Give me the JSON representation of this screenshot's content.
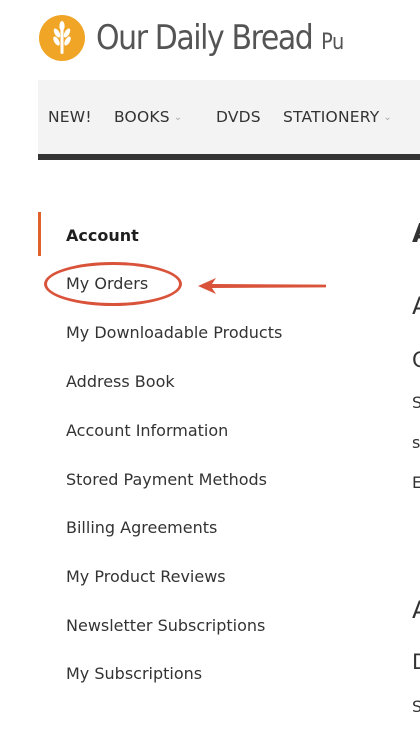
{
  "brand": {
    "name": "Our Daily Bread",
    "name_tail": "Pu",
    "logo_color": "#f0a527"
  },
  "nav": {
    "items": [
      {
        "label": "NEW!",
        "has_dropdown": false
      },
      {
        "label": "BOOKS",
        "has_dropdown": true
      },
      {
        "label": "DVDS",
        "has_dropdown": false
      },
      {
        "label": "STATIONERY",
        "has_dropdown": true
      }
    ]
  },
  "sidebar": {
    "items": [
      {
        "label": "Account",
        "active": true
      },
      {
        "label": "My Orders",
        "highlighted": true
      },
      {
        "label": "My Downloadable Products"
      },
      {
        "label": "Address Book"
      },
      {
        "label": "Account Information"
      },
      {
        "label": "Stored Payment Methods"
      },
      {
        "label": "Billing Agreements"
      },
      {
        "label": "My Product Reviews"
      },
      {
        "label": "Newsletter Subscriptions"
      },
      {
        "label": "My Subscriptions"
      }
    ]
  },
  "main": {
    "fragments": [
      "A",
      "A",
      "C",
      "S",
      "s",
      "E",
      "A",
      "D",
      "S"
    ]
  },
  "annotation": {
    "color": "#d9533b"
  }
}
